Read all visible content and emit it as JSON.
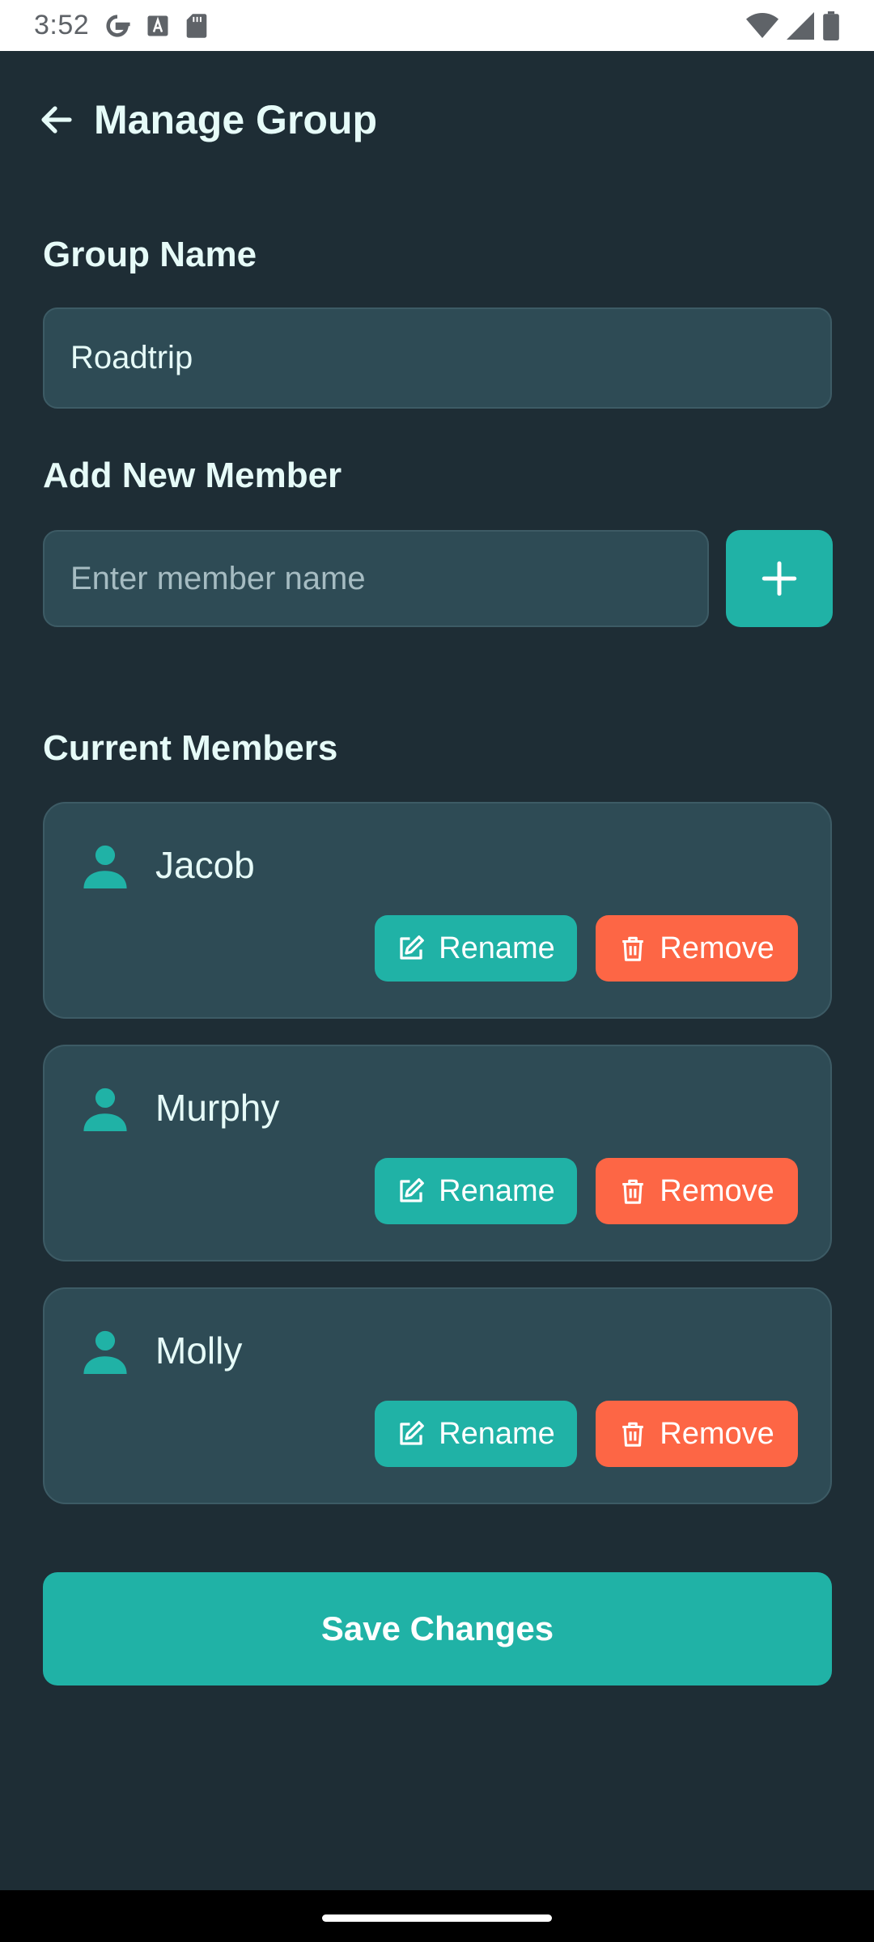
{
  "status_bar": {
    "time": "3:52",
    "left_icons": [
      "google-icon",
      "font-a-icon",
      "sd-card-icon"
    ],
    "right_icons": [
      "wifi-icon",
      "signal-icon",
      "battery-icon"
    ]
  },
  "header": {
    "title": "Manage Group",
    "back_icon": "arrow-left-icon"
  },
  "group_name": {
    "label": "Group Name",
    "value": "Roadtrip"
  },
  "add_member": {
    "label": "Add New Member",
    "placeholder": "Enter member name",
    "value": "",
    "button_icon": "plus-icon"
  },
  "members": {
    "label": "Current Members",
    "items": [
      {
        "name": "Jacob"
      },
      {
        "name": "Murphy"
      },
      {
        "name": "Molly"
      }
    ],
    "rename_label": "Rename",
    "remove_label": "Remove"
  },
  "save_button": {
    "label": "Save Changes"
  },
  "colors": {
    "background": "#1e2d35",
    "card": "#2e4b55",
    "accent": "#20b2a6",
    "danger": "#fd6645",
    "text": "#e6fbf8"
  }
}
